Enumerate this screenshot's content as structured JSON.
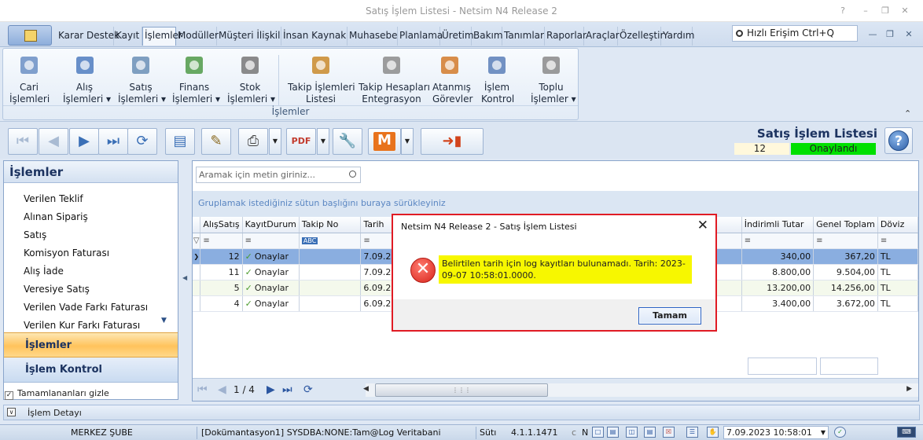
{
  "window": {
    "title": "Satış İşlem Listesi - Netsim N4 Release 2"
  },
  "menu": {
    "tabs": [
      "Karar Destek",
      "Kayıt",
      "İşlemler",
      "Modüller",
      "Müşteri İlişkile",
      "İnsan Kaynakl",
      "Muhasebe",
      "Planlama",
      "Üretim",
      "Bakım",
      "Tanımlar",
      "Raporlar",
      "Araçlar",
      "Özelleştir",
      "Yardım"
    ],
    "active": "İşlemler",
    "quick_access": "Hızlı Erişim Ctrl+Q"
  },
  "ribbon": {
    "buttons": [
      {
        "line1": "Cari",
        "line2": "İşlemleri",
        "icon": "cari-icon"
      },
      {
        "line1": "Alış",
        "line2": "İşlemleri ▾",
        "icon": "cart-icon"
      },
      {
        "line1": "Satış",
        "line2": "İşlemleri ▾",
        "icon": "hand-cart-icon"
      },
      {
        "line1": "Finans",
        "line2": "İşlemleri ▾",
        "icon": "finance-icon"
      },
      {
        "line1": "Stok",
        "line2": "İşlemleri ▾",
        "icon": "barcode-icon"
      },
      {
        "line1": "Takip İşlemleri",
        "line2": "Listesi",
        "icon": "people-list-icon"
      },
      {
        "line1": "Takip Hesapları",
        "line2": "Entegrasyon",
        "icon": "printer-docs-icon"
      },
      {
        "line1": "Atanmış",
        "line2": "Görevler",
        "icon": "group-icon"
      },
      {
        "line1": "İşlem",
        "line2": "Kontrol",
        "icon": "checklist-icon"
      },
      {
        "line1": "Toplu",
        "line2": "İşlemler ▾",
        "icon": "funnel-icon"
      }
    ],
    "group_label": "İşlemler"
  },
  "header": {
    "title": "Satış İşlem Listesi",
    "count": "12",
    "status": "Onaylandı",
    "status_color": "#00e000"
  },
  "nav": {
    "header": "İşlemler",
    "items": [
      "Verilen Teklif",
      "Alınan Sipariş",
      "Satış",
      "Komisyon Faturası",
      "Alış İade",
      "Veresiye Satış",
      "Verilen Vade Farkı Faturası",
      "Verilen Kur Farkı Faturası"
    ],
    "active_section": "İşlemler",
    "second_section": "İşlem Kontrol",
    "hide_completed": "Tamamlananları gizle",
    "detail": "İşlem Detayı"
  },
  "grid": {
    "search_placeholder": "Aramak için metin giriniz...",
    "group_hint": "Gruplamak istediğiniz sütun başlığını buraya sürükleyiniz",
    "columns": [
      "AlışSatış",
      "KayıtDurum",
      "Takip No",
      "Tarih",
      "İndirimli Tutar",
      "Genel Toplam",
      "Döviz"
    ],
    "filter_abc": "ABC",
    "rows": [
      {
        "no": "12",
        "durum": "Onaylar",
        "tarih": "7.09.2023 1",
        "indirimli": "340,00",
        "toplam": "367,20",
        "doviz": "TL"
      },
      {
        "no": "11",
        "durum": "Onaylar",
        "tarih": "7.09.2023 1",
        "indirimli": "8.800,00",
        "toplam": "9.504,00",
        "doviz": "TL"
      },
      {
        "no": "5",
        "durum": "Onaylar",
        "tarih": "6.09.2023 1",
        "indirimli": "13.200,00",
        "toplam": "14.256,00",
        "doviz": "TL"
      },
      {
        "no": "4",
        "durum": "Onaylar",
        "tarih": "6.09.2023 1",
        "indirimli": "3.400,00",
        "toplam": "3.672,00",
        "doviz": "TL"
      }
    ],
    "page": "1 / 4"
  },
  "dialog": {
    "title": "Netsim N4 Release 2 - Satış İşlem Listesi",
    "message": "Belirtilen tarih için log kayıtları bulunamadı. Tarih: 2023-09-07 10:58:01.0000.",
    "ok": "Tamam",
    "highlight_color": "#f7f700"
  },
  "status": {
    "branch": "MERKEZ ŞUBE",
    "session": "[Dokümantasyon1] SYSDBA:NONE:Tam@Log Veritabani",
    "module": "Sütı",
    "version": "4.1.1.1471",
    "caps": "c",
    "num": "N",
    "datetime": "7.09.2023 10:58:01"
  }
}
